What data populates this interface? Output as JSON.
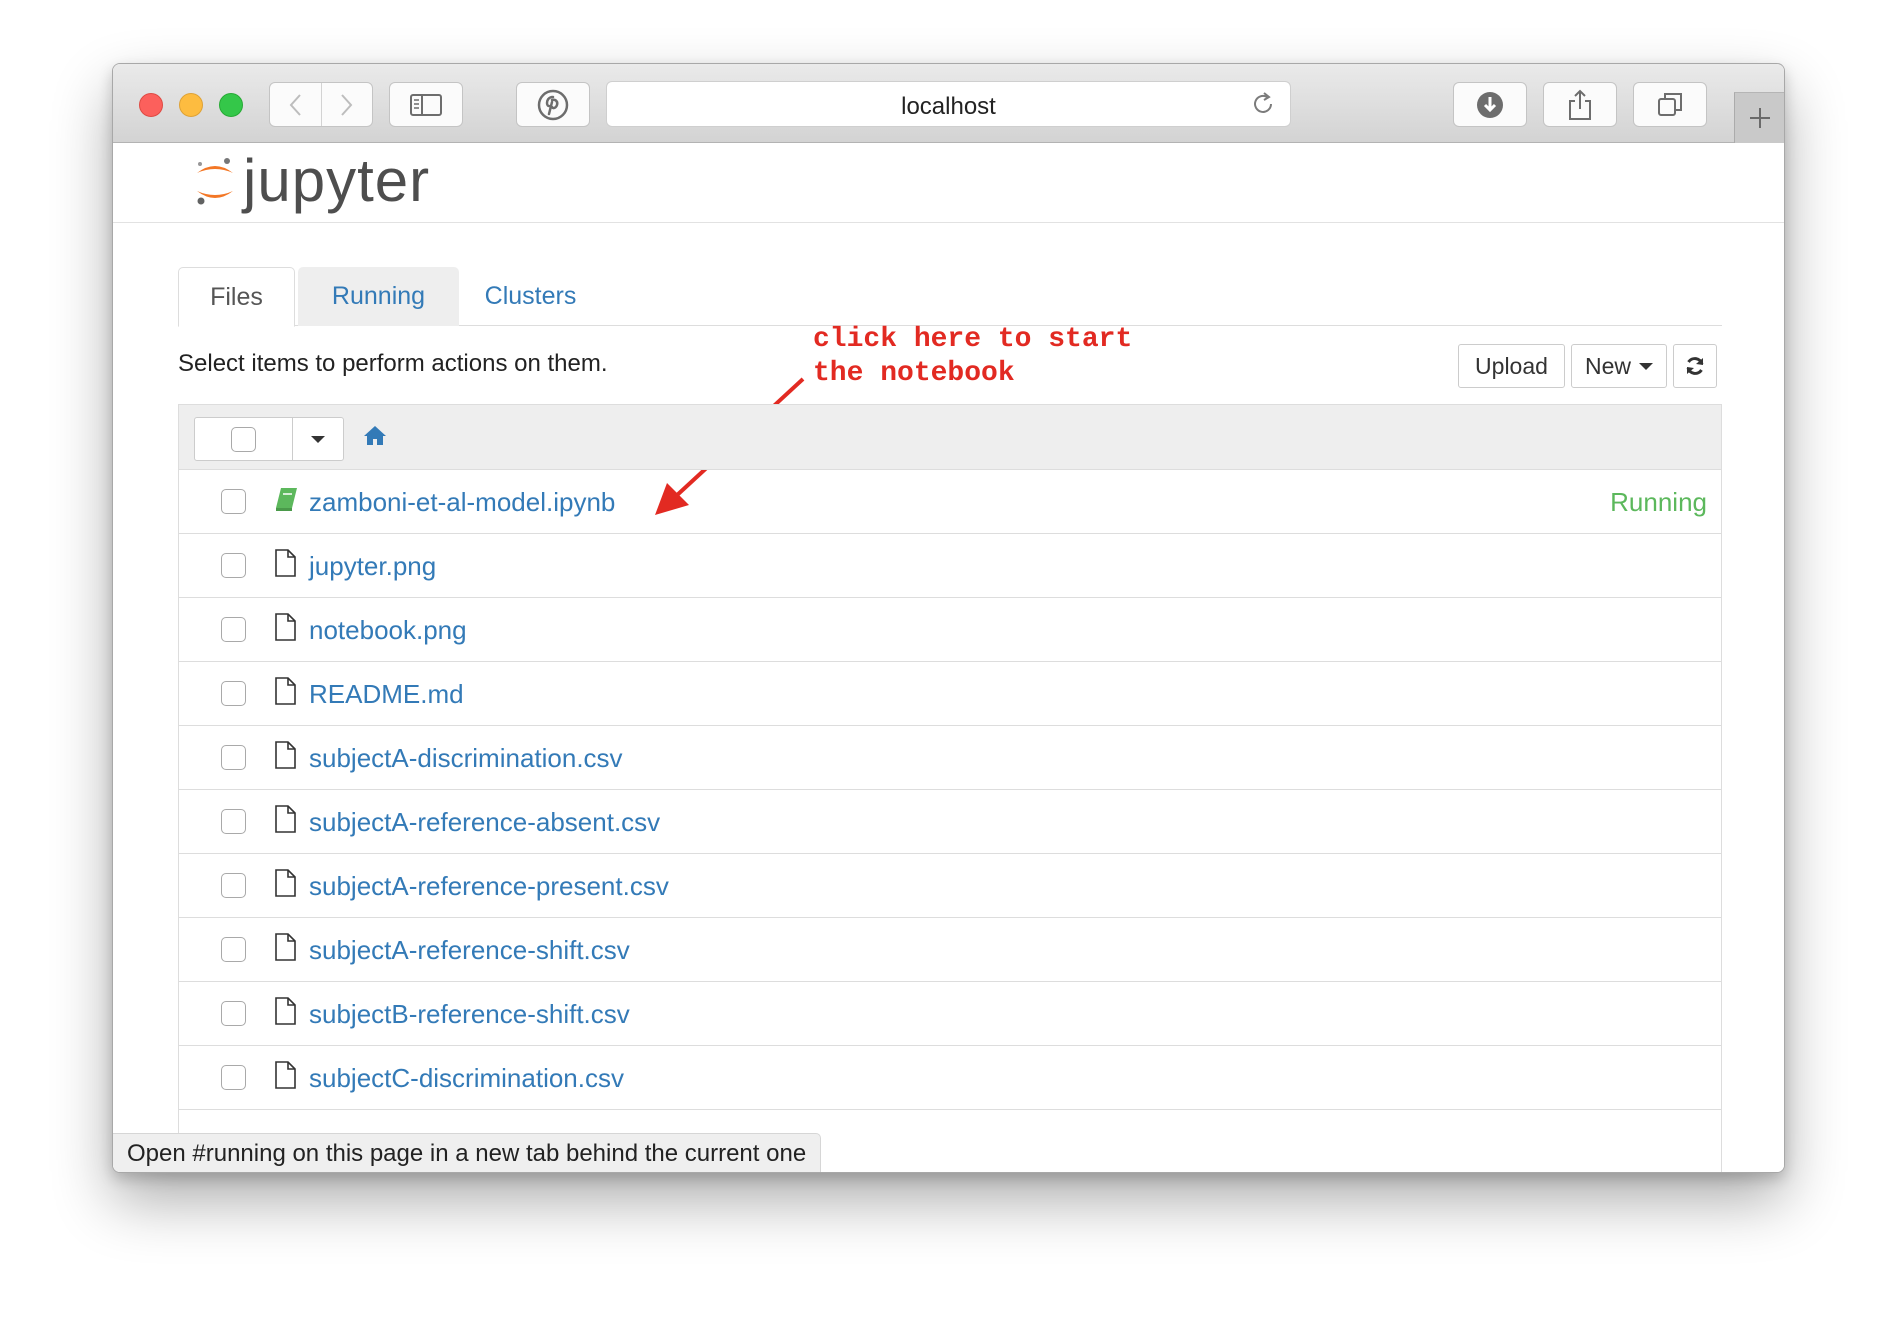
{
  "browser": {
    "url": "localhost"
  },
  "app": {
    "logo_text": "jupyter"
  },
  "tabs": [
    {
      "label": "Files"
    },
    {
      "label": "Running"
    },
    {
      "label": "Clusters"
    }
  ],
  "toolbar": {
    "instruction": "Select items to perform actions on them.",
    "upload_label": "Upload",
    "new_label": "New"
  },
  "annotation": {
    "text": "click here to start\nthe notebook",
    "color": "#e22a22"
  },
  "files": [
    {
      "name": "zamboni-et-al-model.ipynb",
      "type": "notebook",
      "status": "Running"
    },
    {
      "name": "jupyter.png",
      "type": "file",
      "status": ""
    },
    {
      "name": "notebook.png",
      "type": "file",
      "status": ""
    },
    {
      "name": "README.md",
      "type": "file",
      "status": ""
    },
    {
      "name": "subjectA-discrimination.csv",
      "type": "file",
      "status": ""
    },
    {
      "name": "subjectA-reference-absent.csv",
      "type": "file",
      "status": ""
    },
    {
      "name": "subjectA-reference-present.csv",
      "type": "file",
      "status": ""
    },
    {
      "name": "subjectA-reference-shift.csv",
      "type": "file",
      "status": ""
    },
    {
      "name": "subjectB-reference-shift.csv",
      "type": "file",
      "status": ""
    },
    {
      "name": "subjectC-discrimination.csv",
      "type": "file",
      "status": ""
    }
  ],
  "statusbar": {
    "text": "Open #running on this page in a new tab behind the current one"
  },
  "colors": {
    "link": "#337ab7",
    "running": "#5cb85c",
    "logo_orange": "#f37726",
    "notebook_icon": "#5cb85c"
  }
}
